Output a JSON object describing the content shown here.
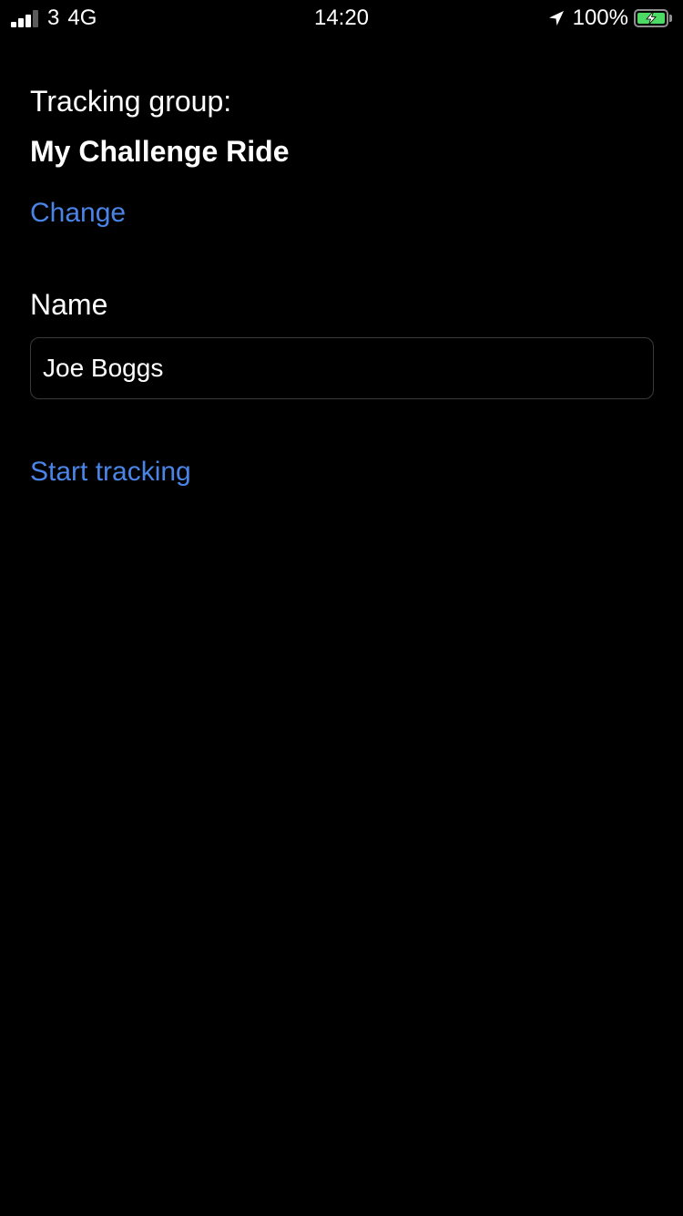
{
  "status_bar": {
    "carrier": "3",
    "network": "4G",
    "time": "14:20",
    "battery_percent": "100%",
    "signal_bars_filled": 3,
    "signal_bars_total": 4,
    "battery_charging": true,
    "battery_color": "#4cd964"
  },
  "form": {
    "group_label": "Tracking group:",
    "group_name": "My Challenge Ride",
    "change_link": "Change",
    "name_label": "Name",
    "name_value": "Joe Boggs",
    "start_link": "Start tracking"
  },
  "colors": {
    "background": "#000000",
    "text": "#ffffff",
    "link": "#4a84e6",
    "input_border": "#3a3a3c"
  },
  "icons": [
    "signal-icon",
    "location-arrow-icon",
    "battery-charging-icon"
  ]
}
